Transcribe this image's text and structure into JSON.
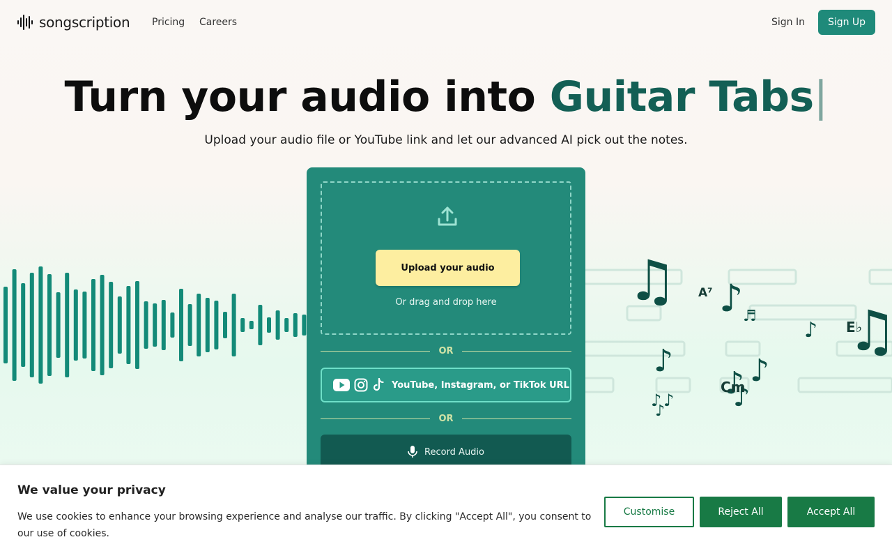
{
  "nav": {
    "brand": "songscription",
    "links": [
      "Pricing",
      "Careers"
    ],
    "sign_in": "Sign In",
    "sign_up": "Sign Up"
  },
  "hero": {
    "title_main": "Turn your audio into ",
    "title_accent": "Guitar Tabs",
    "title_caret": "|",
    "subtitle": "Upload your audio file or YouTube link and let our advanced AI pick out the notes."
  },
  "upload": {
    "button_label": "Upload your audio",
    "drag_text": "Or drag and drop here",
    "or_label": "OR",
    "url_label": "YouTube, Instagram, or TikTok URL",
    "record_label": "Record Audio"
  },
  "music_notes": {
    "chords": [
      "A⁷",
      "E♭",
      "Cm"
    ]
  },
  "cookie": {
    "title": "We value your privacy",
    "text": "We use cookies to enhance your browsing experience and analyse our traffic. By clicking \"Accept All\", you consent to our use of cookies.",
    "customise": "Customise",
    "reject": "Reject All",
    "accept": "Accept All"
  },
  "colors": {
    "brand_teal": "#1f8a7a",
    "card_bg": "#238a7a",
    "accent_text": "#135f55",
    "cookie_green": "#187a45",
    "upload_yellow": "#fdeea0"
  }
}
